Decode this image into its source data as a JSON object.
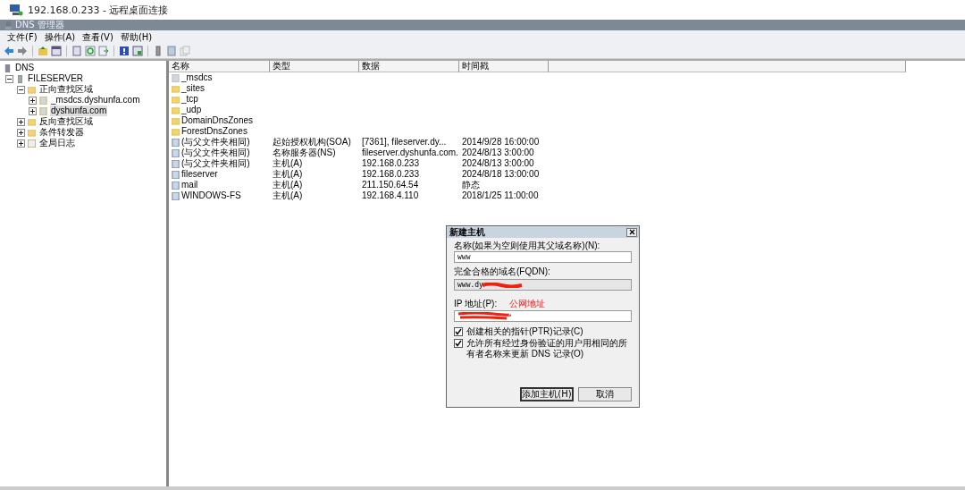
{
  "window": {
    "title": "192.168.0.233 - 远程桌面连接"
  },
  "app": {
    "title": "DNS 管理器"
  },
  "menu": [
    "文件(F)",
    "操作(A)",
    "查看(V)",
    "帮助(H)"
  ],
  "tree": [
    {
      "label": "DNS",
      "kind": "dns",
      "selected": false,
      "children": [
        {
          "label": "FILESERVER",
          "kind": "server",
          "expanded": true,
          "selected": false,
          "children": [
            {
              "label": "正向查找区域",
              "kind": "folder",
              "expanded": true,
              "selected": false,
              "children": [
                {
                  "label": "_msdcs.dyshunfa.com",
                  "kind": "zone",
                  "expanded": false,
                  "selected": false
                },
                {
                  "label": "dyshunfa.com",
                  "kind": "zone",
                  "expanded": false,
                  "selected": true
                }
              ]
            },
            {
              "label": "反向查找区域",
              "kind": "folder",
              "expanded": false,
              "selected": false
            },
            {
              "label": "条件转发器",
              "kind": "folder",
              "expanded": false,
              "selected": false
            },
            {
              "label": "全局日志",
              "kind": "log",
              "expanded": false,
              "selected": false
            }
          ]
        }
      ]
    }
  ],
  "table": {
    "columns": [
      "名称",
      "类型",
      "数据",
      "时间戳"
    ],
    "rows": [
      {
        "kind": "zone",
        "name": "_msdcs"
      },
      {
        "kind": "folder",
        "name": "_sites"
      },
      {
        "kind": "folder",
        "name": "_tcp"
      },
      {
        "kind": "folder",
        "name": "_udp"
      },
      {
        "kind": "folder",
        "name": "DomainDnsZones"
      },
      {
        "kind": "folder",
        "name": "ForestDnsZones"
      },
      {
        "kind": "record",
        "name": "(与父文件夹相同)",
        "type": "起始授权机构(SOA)",
        "data": "[7361], fileserver.dy...",
        "timestamp": "2014/9/28 16:00:00"
      },
      {
        "kind": "record",
        "name": "(与父文件夹相同)",
        "type": "名称服务器(NS)",
        "data": "fileserver.dyshunfa.com.",
        "timestamp": "2024/8/13 3:00:00"
      },
      {
        "kind": "record",
        "name": "(与父文件夹相同)",
        "type": "主机(A)",
        "data": "192.168.0.233",
        "timestamp": "2024/8/13 3:00:00"
      },
      {
        "kind": "record",
        "name": "fileserver",
        "type": "主机(A)",
        "data": "192.168.0.233",
        "timestamp": "2024/8/18 13:00:00"
      },
      {
        "kind": "record",
        "name": "mail",
        "type": "主机(A)",
        "data": "211.150.64.54",
        "timestamp": "静态"
      },
      {
        "kind": "record",
        "name": "WINDOWS-FS",
        "type": "主机(A)",
        "data": "192.168.4.110",
        "timestamp": "2018/1/25 11:00:00"
      }
    ]
  },
  "dialog": {
    "title": "新建主机",
    "name_label": "名称(如果为空则使用其父域名称)(N):",
    "name_value": "www",
    "fqdn_label": "完全合格的域名(FQDN):",
    "fqdn_value": "www.dy",
    "ip_label": "IP 地址(P):",
    "annotation": "公网地址",
    "checkboxes": [
      {
        "label": "创建相关的指针(PTR)记录(C)",
        "checked": true
      },
      {
        "label": "允许所有经过身份验证的用户用相同的所有者名称来更新 DNS 记录(O)",
        "checked": true
      }
    ],
    "buttons": [
      {
        "label": "添加主机(H)",
        "default": true
      },
      {
        "label": "取消",
        "default": false
      }
    ]
  }
}
